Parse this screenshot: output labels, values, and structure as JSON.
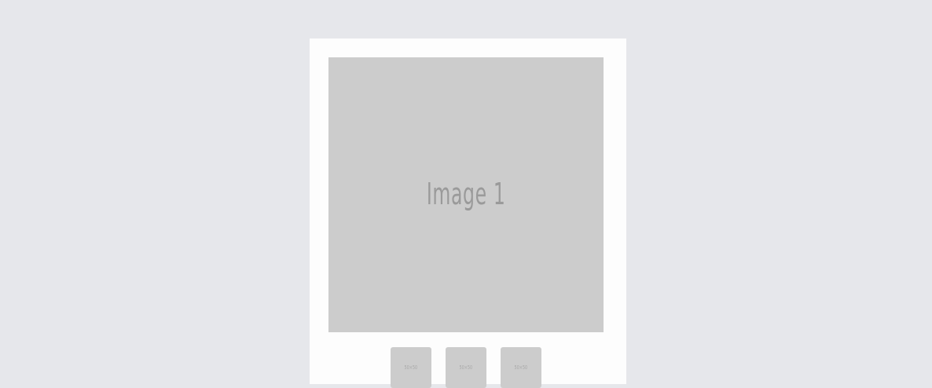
{
  "gallery": {
    "main_image": {
      "label": "Image 1",
      "color": "#cccccc"
    },
    "thumbnails": [
      {
        "label": "50×50"
      },
      {
        "label": "50×50"
      },
      {
        "label": "50×50"
      }
    ]
  },
  "colors": {
    "page_background": "#e6e7eb",
    "card_background": "#fdfdfd",
    "placeholder": "#cccccc",
    "placeholder_text": "#9a9a9a"
  }
}
